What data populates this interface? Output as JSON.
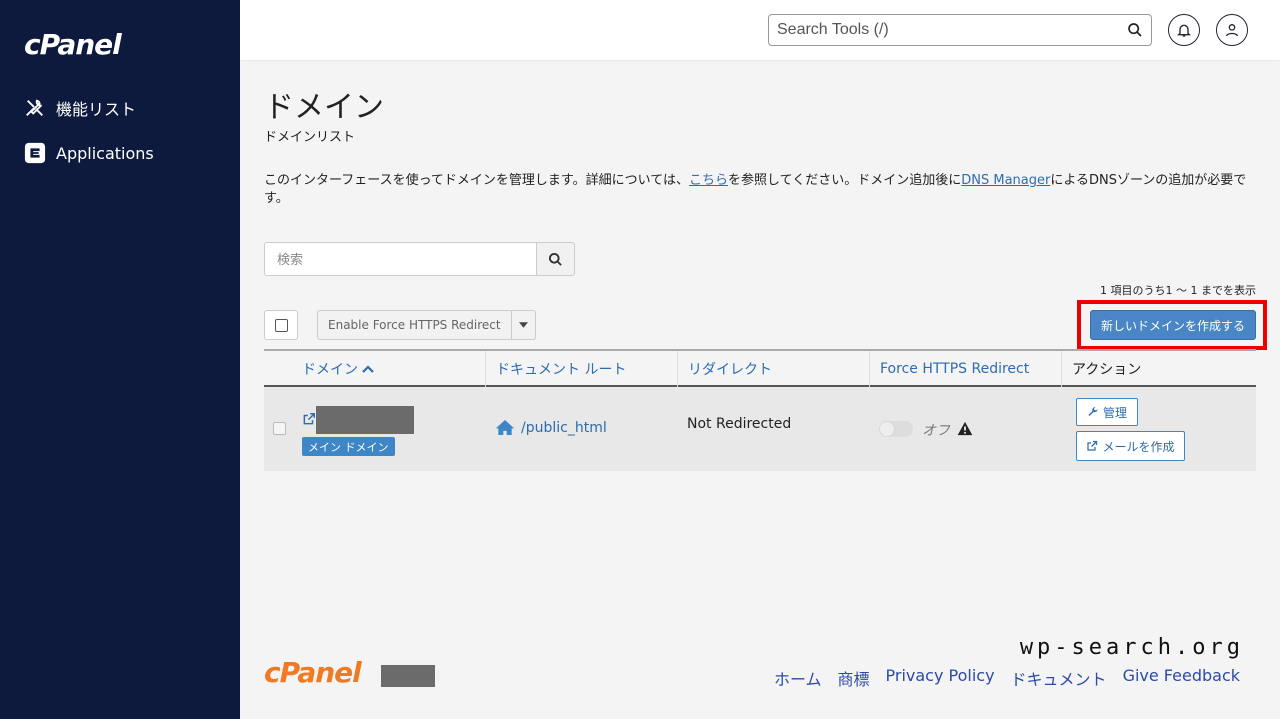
{
  "sidebar": {
    "logo": "cPanel",
    "items": [
      {
        "label": "機能リスト",
        "icon": "tools-icon"
      },
      {
        "label": "Applications",
        "icon": "applications-icon"
      }
    ]
  },
  "header": {
    "search_placeholder": "Search Tools (/)",
    "icons": [
      "search-icon",
      "bell-icon",
      "user-icon"
    ]
  },
  "page": {
    "title": "ドメイン",
    "subtitle": "ドメインリスト",
    "intro_before": "このインターフェースを使ってドメインを管理します。詳細については、",
    "intro_link1": "こちら",
    "intro_middle": "を参照してください。ドメイン追加後に",
    "intro_link2": "DNS Manager",
    "intro_after": "によるDNSゾーンの追加が必要です。"
  },
  "filter": {
    "placeholder": "検索"
  },
  "count_text": "1 項目のうち1 〜 1 までを表示",
  "toolbar": {
    "https_button": "Enable Force HTTPS Redirect",
    "create_button": "新しいドメインを作成する"
  },
  "table": {
    "headers": [
      "ドメイン",
      "ドキュメント ルート",
      "リダイレクト",
      "Force HTTPS Redirect",
      "アクション"
    ],
    "rows": [
      {
        "badge": "メイン ドメイン",
        "docroot": "/public_html",
        "redirect": "Not Redirected",
        "https_state": "オフ",
        "manage": "管理",
        "mail": "メールを作成"
      }
    ]
  },
  "footer": {
    "logo": "cPanel",
    "links": [
      "ホーム",
      "商標",
      "Privacy Policy",
      "ドキュメント",
      "Give Feedback"
    ]
  },
  "watermark": "wp-search.org",
  "colors": {
    "sidebar_bg": "#0d1a3e",
    "accent_blue": "#4a86c5",
    "link_blue": "#2c6cb0",
    "highlight_red": "#ee0000",
    "footer_logo": "#f07a23"
  }
}
